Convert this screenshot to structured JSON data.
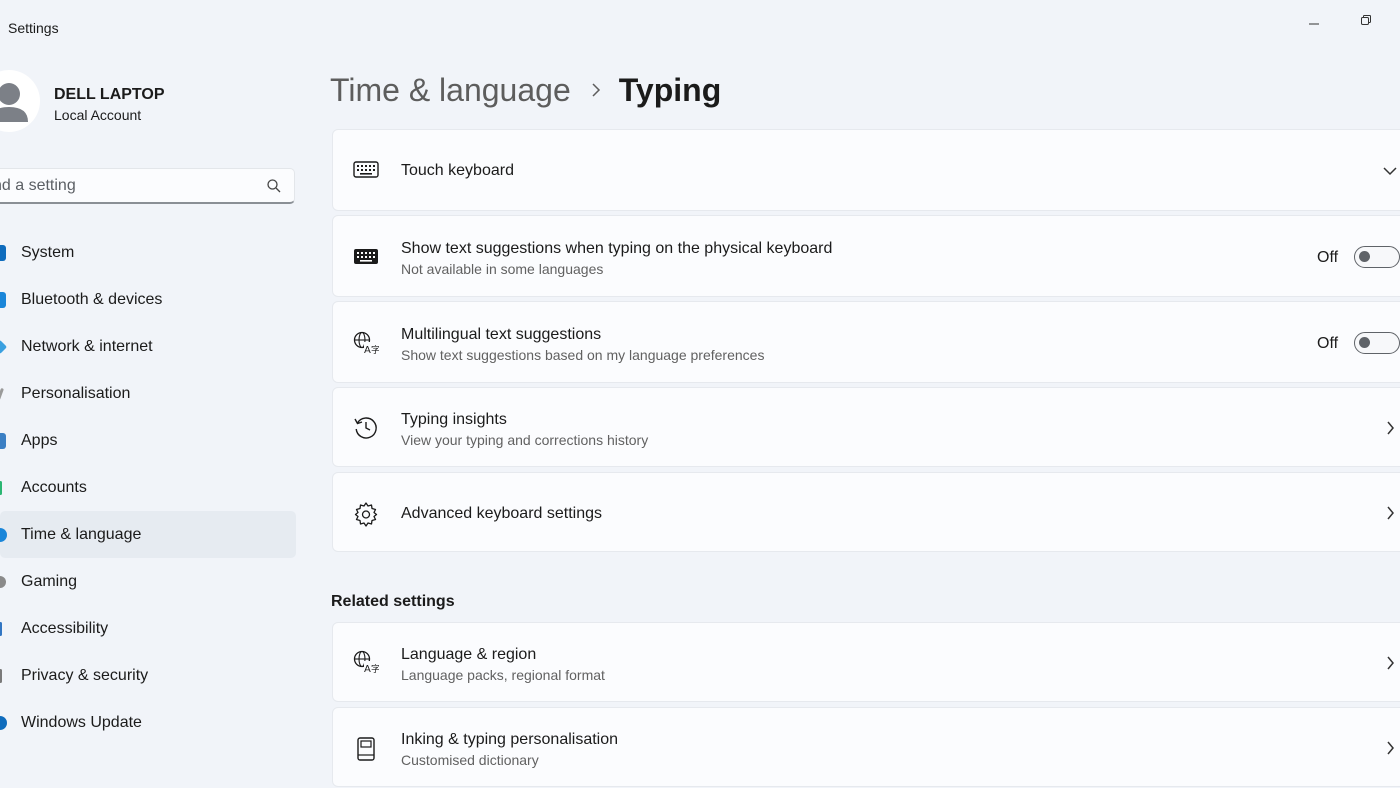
{
  "window": {
    "title": "Settings",
    "minimize_glyph": "—",
    "restore_icon": "restore-icon"
  },
  "profile": {
    "name": "DELL LAPTOP",
    "account_type": "Local Account"
  },
  "search": {
    "placeholder": "nd a setting"
  },
  "sidebar": {
    "items": [
      {
        "label": "System",
        "color": "#0f6cbd"
      },
      {
        "label": "Bluetooth & devices",
        "color": "#1a86d9"
      },
      {
        "label": "Network & internet",
        "color": "#3aa0e0"
      },
      {
        "label": "Personalisation",
        "color": "#9a9a9a"
      },
      {
        "label": "Apps",
        "color": "#3b7fc4"
      },
      {
        "label": "Accounts",
        "color": "#2bb673"
      },
      {
        "label": "Time & language",
        "color": "#1a86d9",
        "active": true
      },
      {
        "label": "Gaming",
        "color": "#8a8a8a"
      },
      {
        "label": "Accessibility",
        "color": "#3276c3"
      },
      {
        "label": "Privacy & security",
        "color": "#7a7a7a"
      },
      {
        "label": "Windows Update",
        "color": "#0f6cbd"
      }
    ]
  },
  "breadcrumb": {
    "parent": "Time & language",
    "current": "Typing"
  },
  "cards": [
    {
      "title": "Touch keyboard",
      "icon": "keyboard-icon"
    },
    {
      "title": "Show text suggestions when typing on the physical keyboard",
      "subtitle": "Not available in some languages",
      "toggle": "Off",
      "icon": "keyboard-filled-icon"
    },
    {
      "title": "Multilingual text suggestions",
      "subtitle": "Show text suggestions based on my language preferences",
      "toggle": "Off",
      "icon": "language-icon"
    },
    {
      "title": "Typing insights",
      "subtitle": "View your typing and corrections history",
      "icon": "history-icon"
    },
    {
      "title": "Advanced keyboard settings",
      "icon": "gear-icon"
    }
  ],
  "related": {
    "title": "Related settings",
    "cards": [
      {
        "title": "Language & region",
        "subtitle": "Language packs, regional format",
        "icon": "language-icon"
      },
      {
        "title": "Inking & typing personalisation",
        "subtitle": "Customised dictionary",
        "icon": "notebook-icon"
      }
    ]
  }
}
